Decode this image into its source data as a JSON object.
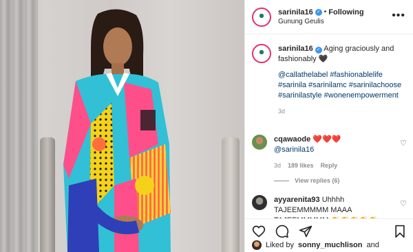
{
  "post": {
    "username": "sarinila16",
    "follow_label": "Following",
    "separator": "•",
    "location": "Gunung Geulis",
    "more_label": "•••"
  },
  "caption": {
    "username": "sarinila16",
    "text": "Aging graciously and fashionably",
    "heart": "🖤",
    "hashtags": "@callathelabel #fashionablelife #sarinila #sarinilamc #sarinilachoose #sarinilastyle #wonenempowerment",
    "time": "3d"
  },
  "comments": [
    {
      "username": "cqawaode",
      "hearts": "❤️❤️❤️",
      "mention": "@sarinila16",
      "time": "3d",
      "likes": "189 likes",
      "reply": "Reply"
    },
    {
      "username": "ayyarenita93",
      "text": "Uhhhh TAJEEMMMMM MAAA TAJEEMMMMM",
      "emojis": "👏👏👏👏👏"
    }
  ],
  "view_replies": "View replies (6)",
  "likes_line": {
    "prefix": "Liked by",
    "user": "sonny_muchlison",
    "suffix": "and"
  },
  "icons": [
    "heart-icon",
    "comment-icon",
    "share-icon",
    "bookmark-icon",
    "verified-icon"
  ],
  "colors": {
    "link": "#00376b",
    "verified": "#3897f0",
    "muted": "#8e8e8e",
    "ring": "#e1306c"
  }
}
